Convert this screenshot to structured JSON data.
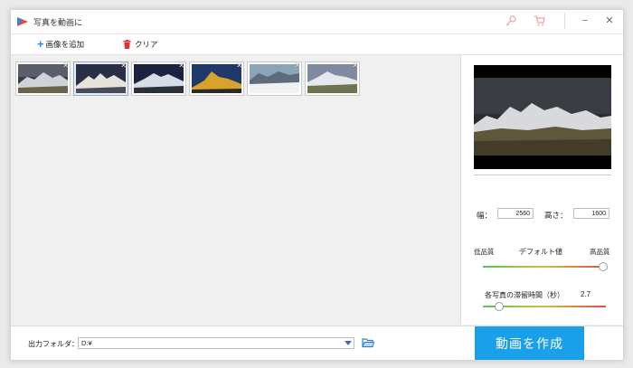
{
  "app": {
    "title": "写真を動画に"
  },
  "window_controls": {
    "minimize": "−",
    "close": "✕"
  },
  "toolbar": {
    "add_label": "画像を追加",
    "clear_label": "クリア"
  },
  "thumbnails": [
    {
      "id": 1,
      "close": "✕",
      "selected": false
    },
    {
      "id": 2,
      "close": "✕",
      "selected": true
    },
    {
      "id": 3,
      "close": "✕",
      "selected": false
    },
    {
      "id": 4,
      "close": "✕",
      "selected": false
    },
    {
      "id": 5,
      "close": "✕",
      "selected": false
    },
    {
      "id": 6,
      "close": "✕",
      "selected": false
    }
  ],
  "settings": {
    "width_label": "幅：",
    "width_value": "2560",
    "height_label": "高さ：",
    "height_value": "1600",
    "quality_low": "低品質",
    "quality_default": "デフォルト値",
    "quality_high": "高品質",
    "quality_level": 1.0,
    "duration_label": "各写真の滞留時間（秒）",
    "duration_value": "2.7",
    "duration_level": 0.08
  },
  "output": {
    "label": "出力フォルダ：",
    "path": "D:¥"
  },
  "actions": {
    "create_label": "動画を作成"
  },
  "colors": {
    "accent": "#1aa0e8",
    "add_plus": "#2a8bf2",
    "clear_icon": "#e03030"
  }
}
